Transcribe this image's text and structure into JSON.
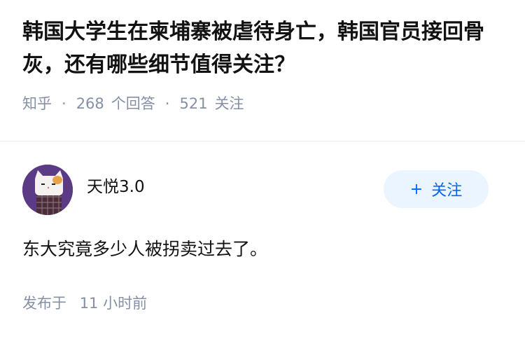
{
  "question": {
    "title": "韩国大学生在柬埔寨被虐待身亡，韩国官员接回骨灰，还有哪些细节值得关注？",
    "source": "知乎",
    "separator": "·",
    "answer_count": "268",
    "answer_label": "个回答",
    "follower_count": "521",
    "follower_label": "关注"
  },
  "answer": {
    "author_name": "天悦3.0",
    "avatar_icon": "cat-avatar-icon",
    "follow_plus": "+",
    "follow_label": "关注",
    "content": "东大究竟多少人被拐卖过去了。",
    "published_label": "发布于",
    "published_time": "11 小时前"
  },
  "colors": {
    "accent": "#0066ff",
    "follow_bg": "#ebf5ff",
    "meta_text": "#8590a6",
    "avatar_bg": "#5b3a86"
  }
}
